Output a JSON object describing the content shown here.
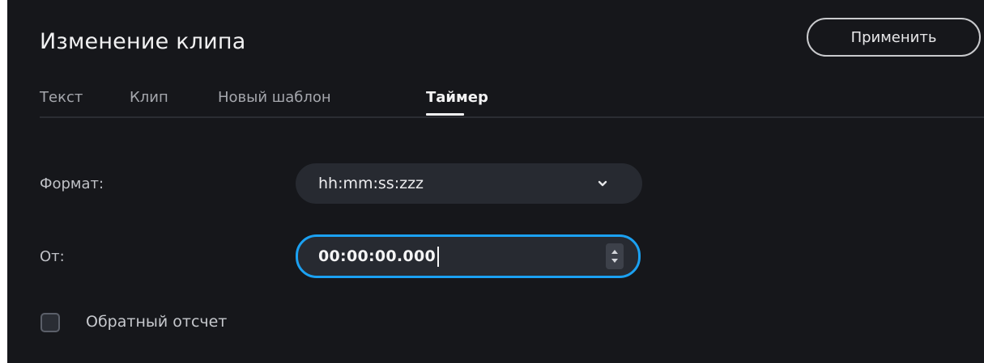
{
  "header": {
    "title": "Изменение клипа",
    "apply_label": "Применить"
  },
  "tabs": [
    {
      "label": "Текст",
      "active": false
    },
    {
      "label": "Клип",
      "active": false
    },
    {
      "label": "Новый шаблон",
      "active": false
    },
    {
      "label": "Таймер",
      "active": true
    }
  ],
  "form": {
    "format_label": "Формат:",
    "format_value": "hh:mm:ss:zzz",
    "from_label": "От:",
    "from_value": "00:00:00.000",
    "countdown_label": "Обратный отсчет",
    "countdown_checked": false
  },
  "colors": {
    "background": "#16171b",
    "accent": "#1ba1f2",
    "field": "#272a31"
  },
  "icons": {
    "dropdown": "chevron-down-icon",
    "stepper_up": "arrow-up-icon",
    "stepper_down": "arrow-down-icon"
  }
}
